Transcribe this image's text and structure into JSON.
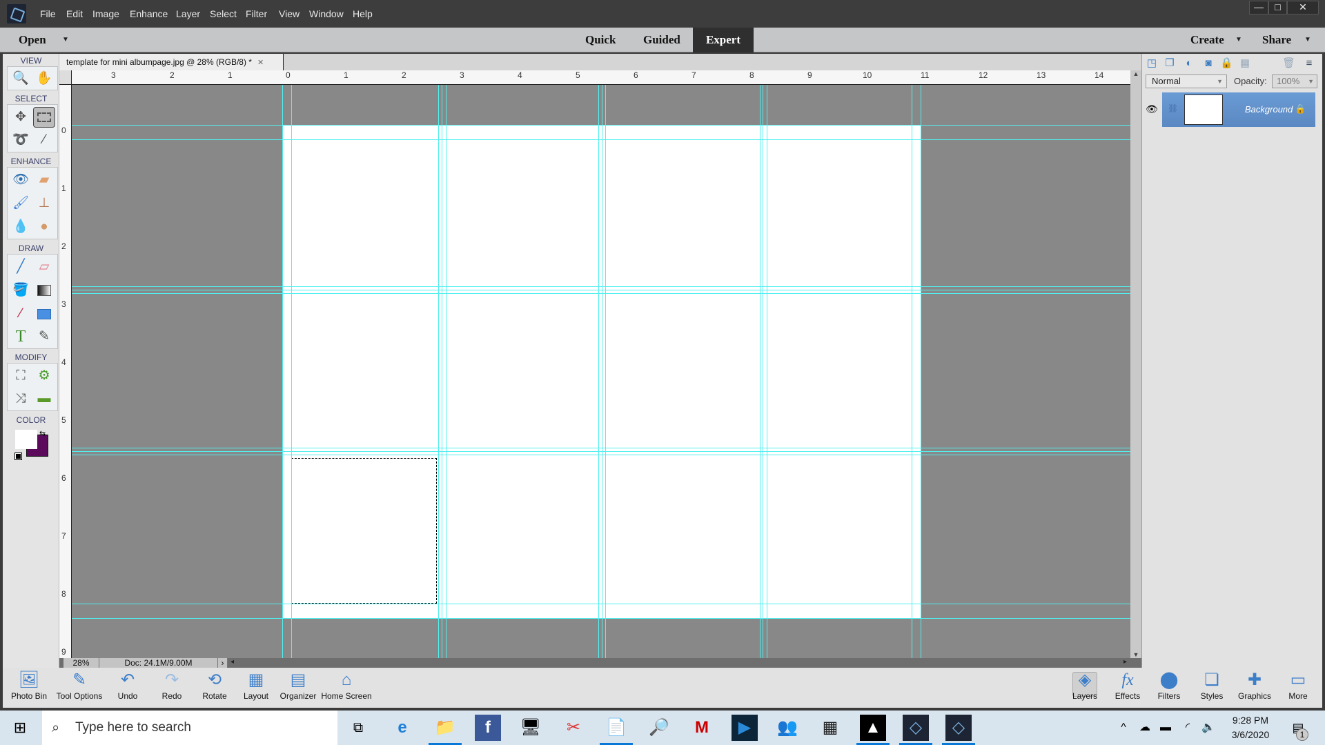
{
  "app": {
    "menu": [
      "File",
      "Edit",
      "Image",
      "Enhance",
      "Layer",
      "Select",
      "Filter",
      "View",
      "Window",
      "Help"
    ],
    "window_controls": {
      "minimize": "—",
      "maximize": "□",
      "close": "✕"
    }
  },
  "modebar": {
    "open_label": "Open",
    "modes": [
      "Quick",
      "Guided",
      "Expert"
    ],
    "active_mode": "Expert",
    "create_label": "Create",
    "share_label": "Share"
  },
  "toolbox": {
    "sections": {
      "view": "VIEW",
      "select": "SELECT",
      "enhance": "ENHANCE",
      "draw": "DRAW",
      "modify": "MODIFY",
      "color": "COLOR"
    },
    "tools": {
      "zoom": "zoom-tool",
      "hand": "hand-tool",
      "move": "move-tool",
      "marquee": "rectangular-marquee-tool",
      "lasso": "lasso-tool",
      "quick_selection": "quick-selection-tool",
      "red_eye": "red-eye-tool",
      "spot_healing": "spot-healing-brush-tool",
      "smart_brush": "smart-brush-tool",
      "clone_stamp": "clone-stamp-tool",
      "blur": "blur-tool",
      "sponge": "sponge-tool",
      "brush": "brush-tool",
      "eraser": "eraser-tool",
      "paint_bucket": "paint-bucket-tool",
      "gradient": "gradient-tool",
      "eyedropper": "eyedropper-tool",
      "shape": "rectangle-shape-tool",
      "type": "type-tool",
      "pencil": "pencil-tool",
      "crop": "crop-tool",
      "recompose": "recompose-tool",
      "content_aware_move": "content-aware-move-tool",
      "straighten": "straighten-tool"
    },
    "active_tool": "rectangular-marquee-tool",
    "colors": {
      "foreground": "#ffffff",
      "background": "#5c0a5c"
    }
  },
  "document": {
    "tab_title": "template for mini albumpage.jpg @ 28% (RGB/8) *",
    "zoom": "28%",
    "doc_info": "Doc: 24.1M/9.00M",
    "hruler_labels": [
      "3",
      "2",
      "1",
      "0",
      "1",
      "2",
      "3",
      "4",
      "5",
      "6",
      "7",
      "8",
      "9",
      "10",
      "11",
      "12",
      "13",
      "14"
    ],
    "vruler_labels": [
      "0",
      "1",
      "2",
      "3",
      "4",
      "5",
      "6",
      "7",
      "8",
      "9"
    ]
  },
  "panel": {
    "blend_mode": "Normal",
    "opacity_label": "Opacity:",
    "opacity_value": "100%",
    "layers": [
      {
        "name": "Background",
        "visible": true,
        "locked": true
      }
    ]
  },
  "bottom_bar": {
    "left": [
      "Photo Bin",
      "Tool Options",
      "Undo",
      "Redo",
      "Rotate",
      "Layout",
      "Organizer",
      "Home Screen"
    ],
    "right": [
      "Layers",
      "Effects",
      "Filters",
      "Styles",
      "Graphics",
      "More"
    ]
  },
  "taskbar": {
    "search_placeholder": "Type here to search",
    "time": "9:28 PM",
    "date": "3/6/2020",
    "notification_count": "1"
  }
}
